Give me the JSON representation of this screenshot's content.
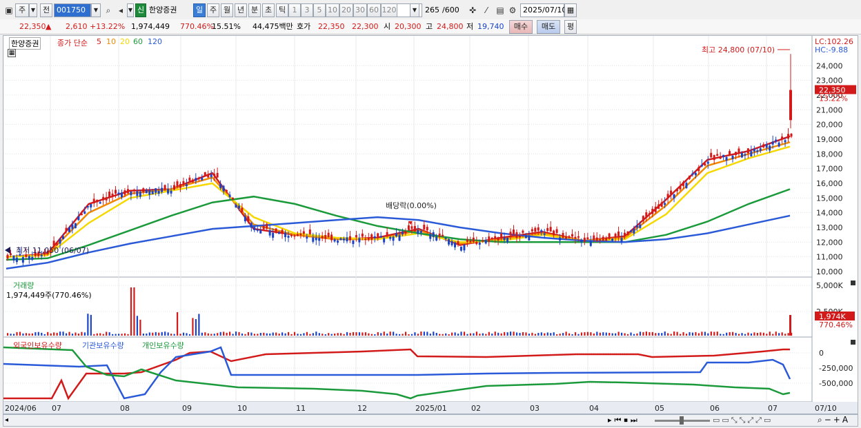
{
  "toolbar": {
    "period_label": "주",
    "prev_label": "전",
    "code": "001750",
    "badge": "신",
    "name": "한양증권",
    "tabs": [
      "일",
      "주",
      "월",
      "년",
      "분",
      "초",
      "틱"
    ],
    "active_tab": "일",
    "nums": [
      "1",
      "3",
      "5",
      "10",
      "20",
      "30",
      "60",
      "120"
    ],
    "count": "265",
    "count_total": "/600",
    "date": "2025/07/10"
  },
  "quote": {
    "price": "22,350",
    "change_arrow": "▲",
    "change": "2,610",
    "change_pct": "+13.22%",
    "volume": "1,974,449",
    "volume_pct": "770.46%",
    "turnover": "15.51%",
    "amount": "44,475백만",
    "ask_label": "호가",
    "ask": "22,350",
    "bid": "22,300",
    "open_label": "시",
    "open": "20,300",
    "high_label": "고",
    "high": "24,800",
    "low_label": "저",
    "low": "19,740",
    "buy": "매수",
    "sell": "매도",
    "eval": "평"
  },
  "legend": {
    "stock": "한양증권",
    "ma_label": "종가 단순",
    "ma_periods": [
      "5",
      "10",
      "20",
      "60",
      "120"
    ],
    "volume_title": "거래량",
    "volume_value": "1,974,449주(770.46%)",
    "holdings": [
      "외국인보유수량",
      "기관보유수량",
      "개인보유수량"
    ]
  },
  "annotations": {
    "high": "최고 24,800 (07/10)",
    "low": "최저 11,050 (06/07)",
    "dividend": "배당락(0.00%)",
    "lc": "LC:102.26",
    "hc": "HC:-9.88",
    "price_tag": "22,350",
    "pct_tag": "13.22%",
    "vol_tag": "1,974K",
    "vol_pct_tag": "770.46%"
  },
  "colors": {
    "up": "#d21a1a",
    "down": "#1a43c8",
    "ma5": "#d21a1a",
    "ma10": "#f08a00",
    "ma20": "#f5d800",
    "ma60": "#1a9a3a",
    "ma120": "#2a5ad8",
    "foreign": "#d21a1a",
    "inst": "#2a5ad8",
    "indiv": "#1a9a3a"
  },
  "chart_data": {
    "type": "line",
    "title": "한양증권",
    "price_axis": [
      "24,000",
      "23,000",
      "22,000",
      "21,000",
      "20,000",
      "19,000",
      "18,000",
      "17,000",
      "16,000",
      "15,000",
      "14,000",
      "13,000",
      "12,000",
      "11,000",
      "10,000"
    ],
    "volume_axis": [
      "5,000K",
      "2,500K"
    ],
    "holdings_axis": [
      "0",
      "-250,000",
      "-500,000"
    ],
    "x_labels": [
      "2024/06",
      "07",
      "08",
      "09",
      "10",
      "11",
      "12",
      "2025/01",
      "02",
      "03",
      "04",
      "05",
      "06",
      "07",
      "07/10"
    ],
    "ylim": [
      10000,
      25000
    ],
    "series": [
      {
        "name": "5",
        "values": [
          11000,
          11200,
          14600,
          15500,
          15600,
          16700,
          12900,
          12500,
          12200,
          12300,
          12900,
          11800,
          12300,
          12700,
          12100,
          12400,
          14900,
          17600,
          18200,
          19200
        ]
      },
      {
        "name": "10",
        "values": [
          11000,
          11150,
          14000,
          15300,
          15600,
          16400,
          13200,
          12500,
          12200,
          12200,
          12800,
          11900,
          12200,
          12600,
          12100,
          12300,
          14500,
          17200,
          18000,
          18800
        ]
      },
      {
        "name": "20",
        "values": [
          11000,
          11100,
          13300,
          15000,
          15500,
          16000,
          13700,
          12600,
          12300,
          12200,
          12600,
          12000,
          12100,
          12500,
          12100,
          12200,
          13900,
          16700,
          17700,
          18500
        ]
      },
      {
        "name": "60",
        "values": [
          10800,
          10900,
          11800,
          12800,
          13800,
          14700,
          15100,
          14600,
          13800,
          13100,
          12600,
          12200,
          12000,
          12000,
          12000,
          12000,
          12500,
          13400,
          14600,
          15600
        ]
      },
      {
        "name": "120",
        "values": [
          10200,
          10600,
          11300,
          11900,
          12400,
          12900,
          13100,
          13300,
          13500,
          13700,
          13500,
          13000,
          12600,
          12300,
          12100,
          12000,
          12200,
          12600,
          13200,
          13800
        ]
      }
    ]
  }
}
